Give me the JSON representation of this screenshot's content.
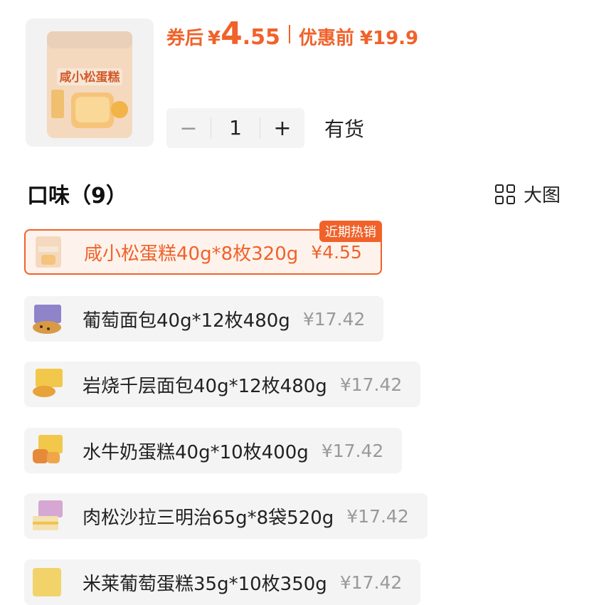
{
  "product": {
    "image_label": "咸小松蛋糕",
    "price_after_coupon_label": "券后",
    "price_after_coupon_symbol": "¥",
    "price_after_coupon_int": "4",
    "price_after_coupon_dec": ".55",
    "price_before_label": "优惠前",
    "price_before": "¥19.9"
  },
  "quantity": {
    "minus": "−",
    "value": "1",
    "plus": "+",
    "stock_status": "有货"
  },
  "flavors": {
    "title": "口味（9）",
    "big_view_label": "大图",
    "options": [
      {
        "name": "咸小松蛋糕40g*8枚320g",
        "price": "¥4.55",
        "badge": "近期热销",
        "selected": true
      },
      {
        "name": "葡萄面包40g*12枚480g",
        "price": "¥17.42",
        "selected": false
      },
      {
        "name": "岩烧千层面包40g*12枚480g",
        "price": "¥17.42",
        "selected": false
      },
      {
        "name": "水牛奶蛋糕40g*10枚400g",
        "price": "¥17.42",
        "selected": false
      },
      {
        "name": "肉松沙拉三明治65g*8袋520g",
        "price": "¥17.42",
        "selected": false
      },
      {
        "name": "米莱葡萄蛋糕35g*10枚350g",
        "price": "¥17.42",
        "selected": false
      }
    ]
  },
  "colors": {
    "accent": "#f0622a",
    "muted": "#999999",
    "option_bg": "#f4f4f4"
  }
}
